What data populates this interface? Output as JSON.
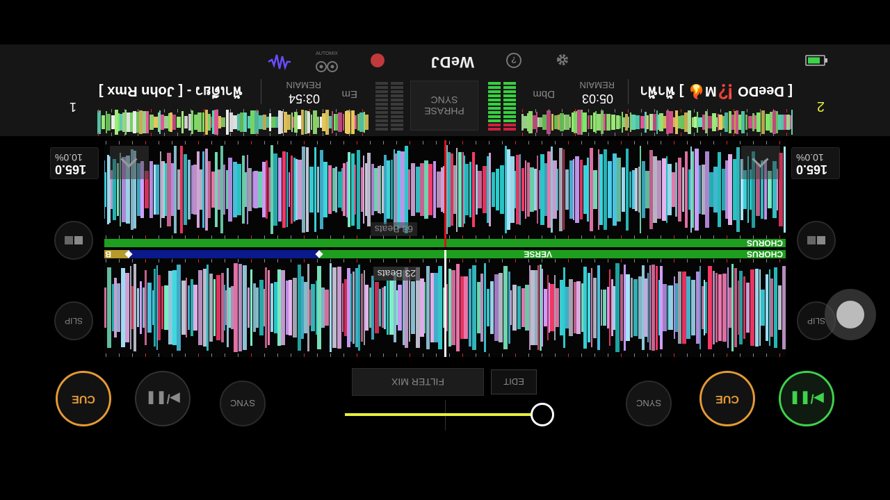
{
  "deck1": {
    "number": "1",
    "title": "[ John Rmx ] - ฟ้าเดียว",
    "remain_label": "REMAIN",
    "remain_time": "03:54",
    "key": "Em",
    "bpm": "165.0",
    "pitch": "10.0%",
    "cue_label": "CUE",
    "play_label": "▶/❚❚",
    "sync_label": "SYNC",
    "slip_label": "SLIP",
    "beats_label": "23 Beats",
    "phrases": [
      {
        "label": "CHORUS",
        "color": "#1e9e1e"
      },
      {
        "label": "VERSE",
        "color": "#0a1a8c"
      },
      {
        "label": "B",
        "color": "#b49b2a"
      }
    ]
  },
  "deck2": {
    "number": "2",
    "title": "[ DeeDO ⁉️M🔥 ] ฟ้าฟ้า",
    "remain_label": "REMAIN",
    "remain_time": "05:03",
    "key": "Dbm",
    "bpm": "165.0",
    "pitch": "10.0%",
    "cue_label": "CUE",
    "play_label": "▶/❚❚",
    "sync_label": "SYNC",
    "slip_label": "SLIP",
    "beats_label": "68 Beats",
    "phrases": [
      {
        "label": "CHORUS",
        "color": "#1e9e1e"
      }
    ]
  },
  "center": {
    "filter_mix_label": "FILTER MIX",
    "edit_label": "EDIT",
    "phrase_sync_label": "PHRASE\nSYNC",
    "crossfader_value": 0
  },
  "bottom_bar": {
    "logo": "WeDJ",
    "automix_label": "AUTOMIX",
    "icons": [
      "waveform-icon",
      "automix-icon",
      "record-icon",
      "help-icon",
      "settings-icon",
      "battery-icon"
    ]
  },
  "colors": {
    "cue": "#e59a36",
    "play_active": "#3fd24b",
    "chorus": "#1e9e1e",
    "verse": "#0a1a8c",
    "crossfader": "#e6f03a",
    "record": "#c0393b",
    "automix_wave": "#6a4cff"
  }
}
